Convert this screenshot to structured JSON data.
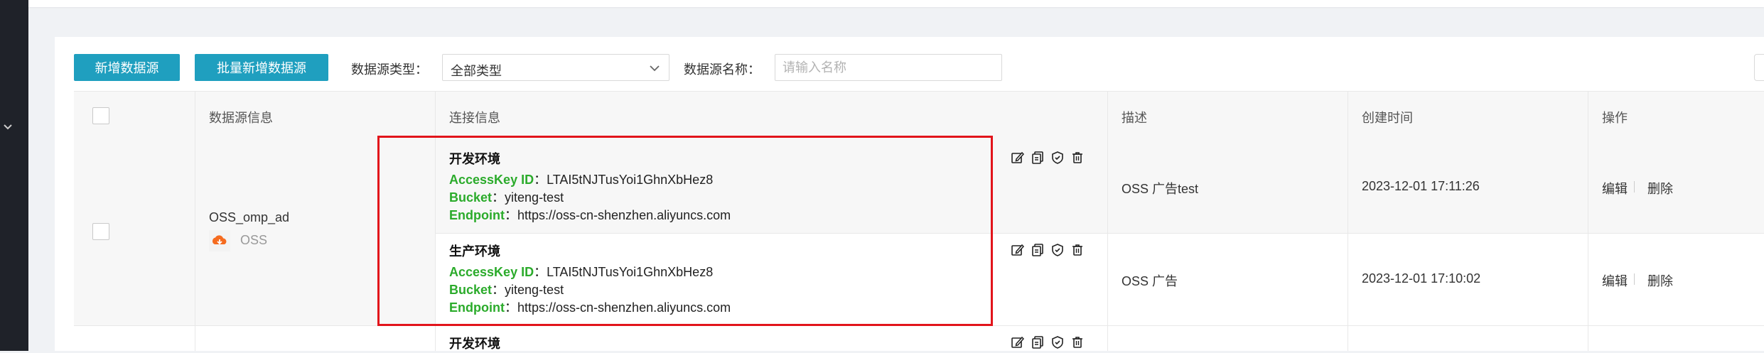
{
  "toolbar": {
    "add_label": "新增数据源",
    "batch_add_label": "批量新增数据源",
    "type_label": "数据源类型：",
    "type_value": "全部类型",
    "name_label": "数据源名称：",
    "name_placeholder": "请输入名称"
  },
  "table": {
    "headers": [
      "数据源信息",
      "连接信息",
      "描述",
      "创建时间",
      "操作"
    ],
    "rows": [
      {
        "source_name": "OSS_omp_ad",
        "source_type": "OSS",
        "envs": [
          {
            "title": "开发环境",
            "access_key_label": "AccessKey ID",
            "access_key": "LTAI5tNJTusYoi1GhnXbHez8",
            "bucket_label": "Bucket",
            "bucket": "yiteng-test",
            "endpoint_label": "Endpoint",
            "endpoint": "https://oss-cn-shenzhen.aliyuncs.com",
            "description": "OSS 广告test",
            "created": "2023-12-01 17:11:26",
            "edit": "编辑",
            "delete": "删除"
          },
          {
            "title": "生产环境",
            "access_key_label": "AccessKey ID",
            "access_key": "LTAI5tNJTusYoi1GhnXbHez8",
            "bucket_label": "Bucket",
            "bucket": "yiteng-test",
            "endpoint_label": "Endpoint",
            "endpoint": "https://oss-cn-shenzhen.aliyuncs.com",
            "description": "OSS 广告",
            "created": "2023-12-01 17:10:02",
            "edit": "编辑",
            "delete": "删除"
          }
        ]
      },
      {
        "envs": [
          {
            "title": "开发环境"
          }
        ]
      }
    ]
  },
  "icons": [
    "edit-icon",
    "copy-icon",
    "shield-icon",
    "trash-icon"
  ],
  "colors": {
    "accent": "#1f9fbf",
    "key_green": "#2bab2b",
    "highlight_red": "#e2141b",
    "sidebar": "#1f2229"
  }
}
